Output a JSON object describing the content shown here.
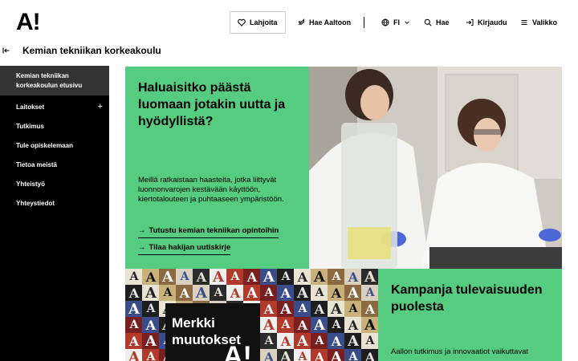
{
  "header": {
    "logo": "A!",
    "donate": "Lahjoita",
    "apply": "Hae Aaltoon",
    "language": "FI",
    "search": "Hae",
    "login": "Kirjaudu",
    "menu": "Valikko"
  },
  "breadcrumb": {
    "title": "Kemian tekniikan korkeakoulu"
  },
  "sidebar": {
    "items": [
      {
        "label": "Kemian tekniikan korkeakoulun etusivu"
      },
      {
        "label": "Laitokset",
        "expand": "+"
      },
      {
        "label": "Tutkimus"
      },
      {
        "label": "Tule opiskelemaan"
      },
      {
        "label": "Tietoa meistä"
      },
      {
        "label": "Yhteistyö"
      },
      {
        "label": "Yhteystiedot"
      }
    ]
  },
  "hero": {
    "title": "Haluaisitko päästä luomaan jotakin uutta ja hyödyllistä?",
    "text": "Meillä ratkaistaan haasteita, jotka liittyvät luonnonvarojen kestävään käyttöön, kiertotalouteen ja puhtaaseen ympäristöön.",
    "link1": "Tutustu kemian tekniikan opintoihin",
    "link2": "Tilaa hakijan uutiskirje",
    "arrow": "→"
  },
  "merkki": {
    "title": "Merkki muutokset",
    "logo": "A!",
    "letter": "A"
  },
  "campaign": {
    "title": "Kampanja tulevaisuuden puolesta",
    "text": "Aallon tutkimus ja innovaatiot vaikuttavat"
  },
  "colors": {
    "accent_green": "#55cc7f",
    "sidebar_bg": "#000000",
    "sidebar_active": "#333333"
  }
}
